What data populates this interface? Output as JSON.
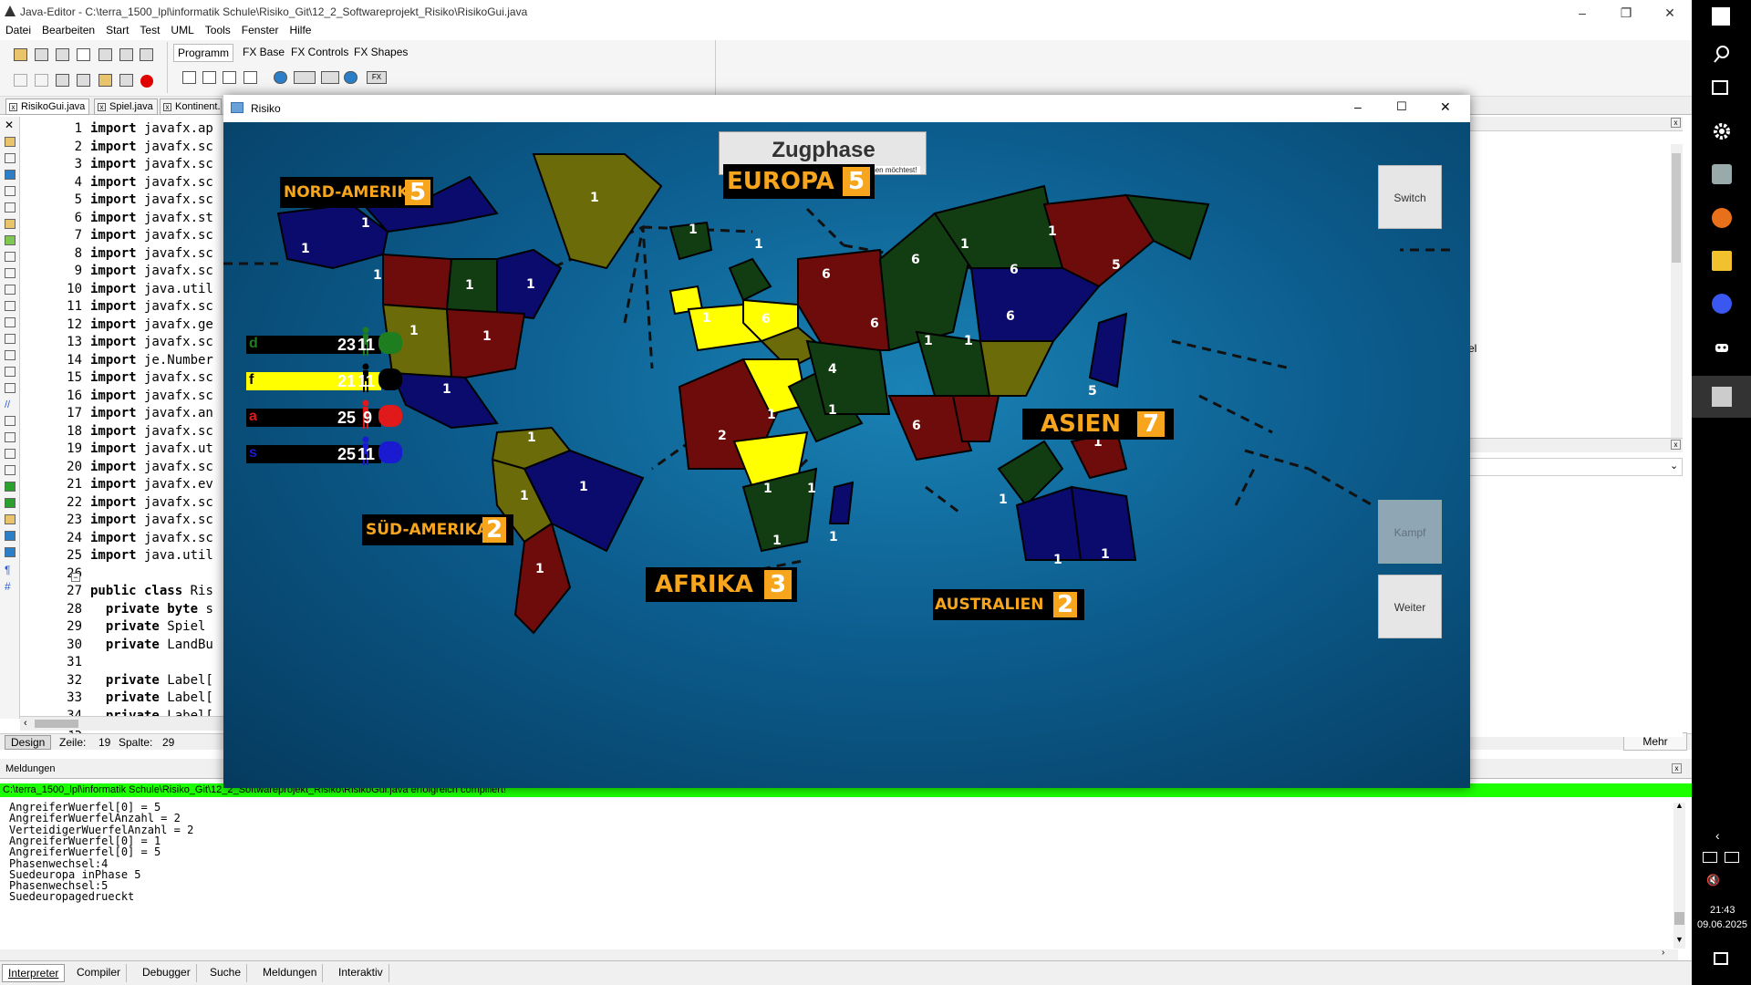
{
  "ide": {
    "title": "Java-Editor - C:\\terra_1500_lpl\\informatik Schule\\Risiko_Git\\12_2_Softwareprojekt_Risiko\\RisikoGui.java",
    "menu": [
      "Datei",
      "Bearbeiten",
      "Start",
      "Test",
      "UML",
      "Tools",
      "Fenster",
      "Hilfe"
    ],
    "palette_tabs": [
      "Programm",
      "FX Base",
      "FX Controls",
      "FX Shapes"
    ],
    "file_tabs": [
      "RisikoGui.java",
      "Spiel.java",
      "Kontinent..."
    ],
    "line_numbers": [
      "1",
      "2",
      "3",
      "4",
      "5",
      "6",
      "7",
      "8",
      "9",
      "10",
      "11",
      "12",
      "13",
      "14",
      "15",
      "16",
      "17",
      "18",
      "19",
      "20",
      "21",
      "22",
      "23",
      "24",
      "25",
      "26",
      "27",
      "28",
      "29",
      "30",
      "31",
      "32",
      "33",
      "34",
      "35"
    ],
    "code_lines": [
      {
        "kw": "import",
        "rest": " javafx.ap"
      },
      {
        "kw": "import",
        "rest": " javafx.sc"
      },
      {
        "kw": "import",
        "rest": " javafx.sc"
      },
      {
        "kw": "import",
        "rest": " javafx.sc"
      },
      {
        "kw": "import",
        "rest": " javafx.sc"
      },
      {
        "kw": "import",
        "rest": " javafx.st"
      },
      {
        "kw": "import",
        "rest": " javafx.sc"
      },
      {
        "kw": "import",
        "rest": " javafx.sc"
      },
      {
        "kw": "import",
        "rest": " javafx.sc"
      },
      {
        "kw": "import",
        "rest": " java.util"
      },
      {
        "kw": "import",
        "rest": " javafx.sc"
      },
      {
        "kw": "import",
        "rest": " javafx.ge"
      },
      {
        "kw": "import",
        "rest": " javafx.sc"
      },
      {
        "kw": "import",
        "rest": " je.Number"
      },
      {
        "kw": "import",
        "rest": " javafx.sc"
      },
      {
        "kw": "import",
        "rest": " javafx.sc"
      },
      {
        "kw": "import",
        "rest": " javafx.an"
      },
      {
        "kw": "import",
        "rest": " javafx.sc"
      },
      {
        "kw": "import",
        "rest": " javafx.ut"
      },
      {
        "kw": "import",
        "rest": " javafx.sc"
      },
      {
        "kw": "import",
        "rest": " javafx.ev"
      },
      {
        "kw": "import",
        "rest": " javafx.sc"
      },
      {
        "kw": "import",
        "rest": " javafx.sc"
      },
      {
        "kw": "import",
        "rest": " javafx.sc"
      },
      {
        "kw": "import",
        "rest": " java.util"
      },
      {
        "kw": "",
        "rest": ""
      },
      {
        "kw": "public class",
        "rest": " Ris"
      },
      {
        "kw": "  private byte",
        "rest": " s"
      },
      {
        "kw": "  private",
        "rest": " Spiel"
      },
      {
        "kw": "  private",
        "rest": " LandBu"
      },
      {
        "kw": "",
        "rest": ""
      },
      {
        "kw": "  private",
        "rest": " Label["
      },
      {
        "kw": "  private",
        "rest": " Label["
      },
      {
        "kw": "  private",
        "rest": " Label["
      },
      {
        "kw": "  private",
        "rest": " Rectan"
      }
    ],
    "design_tab": "Design",
    "zeile_label": "Zeile:",
    "zeile_value": "19",
    "spalte_label": "Spalte:",
    "spalte_value": "29",
    "mehr_button": "Mehr",
    "meldungen_title": "Meldungen",
    "compiled_message": "C:\\terra_1500_lpl\\informatik Schule\\Risiko_Git\\12_2_Softwareprojekt_Risiko\\RisikoGui.java erfolgreich compiliert!",
    "console_lines": [
      "AngreiferWuerfel[0] = 5",
      "AngreiferWuerfelAnzahl = 2",
      "VerteidigerWuerfelAnzahl = 2",
      "AngreiferWuerfel[0] = 1",
      "AngreiferWuerfel[0] = 5",
      "Phasenwechsel:4",
      "Suedeuropa inPhase 5",
      "Phasenwechsel:5",
      "Suedeuropagedrueckt"
    ],
    "bottom_tabs": [
      "Interpreter",
      "Compiler",
      "Debugger",
      "Suche",
      "Meldungen",
      "Interaktiv"
    ],
    "right_panel_fragment": "el"
  },
  "risiko": {
    "window_title": "Risiko",
    "phase_title": "Zugphase",
    "phase_hint": "Wähle das Land, in welches du Truppen ziehen möchtest!",
    "buttons": {
      "switch": "Switch",
      "kampf": "Kampf",
      "weiter": "Weiter"
    },
    "continents": [
      {
        "name": "NORD-AMERIKA",
        "bonus": "5"
      },
      {
        "name": "EUROPA",
        "bonus": "5"
      },
      {
        "name": "ASIEN",
        "bonus": "7"
      },
      {
        "name": "SÜD-AMERIKA",
        "bonus": "2"
      },
      {
        "name": "AFRIKA",
        "bonus": "3"
      },
      {
        "name": "AUSTRALIEN",
        "bonus": "2"
      }
    ],
    "players": [
      {
        "letter": "d",
        "troops": "23",
        "reserve": "11",
        "color": "#1e7d1e",
        "bar": "#000000"
      },
      {
        "letter": "f",
        "troops": "21",
        "reserve": "11",
        "color": "#000000",
        "bar": "#ffff00"
      },
      {
        "letter": "a",
        "troops": "25",
        "reserve": "9",
        "color": "#e01a1a",
        "bar": "#000000"
      },
      {
        "letter": "s",
        "troops": "25",
        "reserve": "11",
        "color": "#1a1ad0",
        "bar": "#000000"
      }
    ],
    "territory_counts": [
      "1",
      "1",
      "1",
      "1",
      "1",
      "1",
      "1",
      "1",
      "1",
      "1",
      "1",
      "1",
      "1",
      "1",
      "6",
      "1",
      "6",
      "6",
      "1",
      "1",
      "6",
      "4",
      "6",
      "5",
      "1",
      "6",
      "5",
      "6",
      "2",
      "1",
      "1",
      "1",
      "1",
      "1",
      "1",
      "1",
      "1",
      "1",
      "1",
      "1",
      "1",
      "1"
    ],
    "colors": {
      "olive": "#6b6b0a",
      "darkred": "#6e0b0b",
      "darkgreen": "#123d12",
      "navy": "#0b0b6e",
      "yellow": "#ffff00",
      "accent": "#f6a51d"
    }
  },
  "taskbar": {
    "time": "21:43",
    "date": "09.06.2025"
  }
}
